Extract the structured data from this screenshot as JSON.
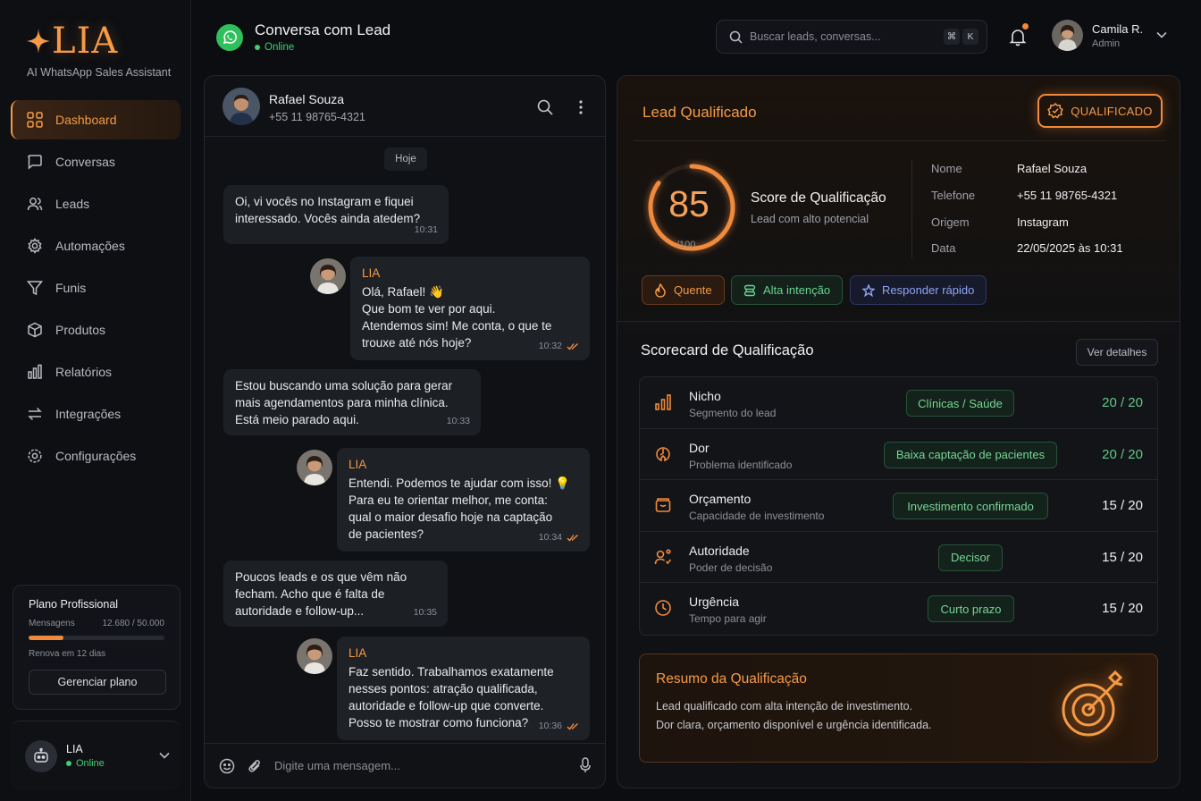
{
  "brand": {
    "name": "LIA",
    "tagline": "AI WhatsApp Sales Assistant",
    "accent": "#f59a45"
  },
  "sidebar": {
    "items": [
      {
        "label": "Dashboard",
        "icon": "grid-icon",
        "active": true
      },
      {
        "label": "Conversas",
        "icon": "chat-bubble-icon"
      },
      {
        "label": "Leads",
        "icon": "users-icon"
      },
      {
        "label": "Automações",
        "icon": "gear-icon"
      },
      {
        "label": "Funis",
        "icon": "funnel-icon"
      },
      {
        "label": "Produtos",
        "icon": "box-icon"
      },
      {
        "label": "Relatórios",
        "icon": "bar-chart-icon"
      },
      {
        "label": "Integrações",
        "icon": "arrows-swap-icon"
      },
      {
        "label": "Configurações",
        "icon": "settings-icon"
      }
    ],
    "plan": {
      "title": "Plano Profissional",
      "messages_label": "Mensagens",
      "messages_value": "12.680 / 50.000",
      "usage_fraction": 0.2536,
      "renew": "Renova em 12 dias",
      "button": "Gerenciar plano"
    },
    "bot": {
      "name": "LIA",
      "status": "Online"
    }
  },
  "header": {
    "title": "Conversa com Lead",
    "status": "Online",
    "search_placeholder": "Buscar leads, conversas...",
    "shortcut_cmd": "⌘",
    "shortcut_key": "K",
    "user": {
      "name": "Camila R.",
      "role": "Admin"
    }
  },
  "chat": {
    "contact": {
      "name": "Rafael Souza",
      "phone": "+55 11 98765-4321"
    },
    "day": "Hoje",
    "messages": [
      {
        "from": "lead",
        "lines": [
          "Oi, vi vocês no Instagram e fiquei",
          "interessado. Vocês ainda atedem?"
        ],
        "time": "10:31"
      },
      {
        "from": "LIA",
        "lines": [
          "Olá, Rafael! 👋",
          "Que bom te ver por aqui.",
          "Atendemos sim! Me conta, o que te",
          "trouxe até nós hoje?"
        ],
        "time": "10:32"
      },
      {
        "from": "lead",
        "lines": [
          "Estou buscando uma solução para gerar",
          "mais agendamentos para minha clínica.",
          "Está meio parado aqui."
        ],
        "time": "10:33"
      },
      {
        "from": "LIA",
        "lines": [
          "Entendi. Podemos te ajudar com isso! 💡",
          "Para eu te orientar melhor, me conta:",
          "qual o maior desafio hoje na captação",
          "de pacientes?"
        ],
        "time": "10:34"
      },
      {
        "from": "lead",
        "lines": [
          "Poucos leads e os que vêm não",
          "fecham. Acho que é falta de",
          "autoridade e follow-up..."
        ],
        "time": "10:35"
      },
      {
        "from": "LIA",
        "lines": [
          "Faz sentido. Trabalhamos exatamente",
          "nesses pontos: atração qualificada,",
          "autoridade e follow-up que converte.",
          "Posso te mostrar como funciona?"
        ],
        "time": "10:36"
      }
    ],
    "composer_placeholder": "Digite uma mensagem..."
  },
  "lead": {
    "title": "Lead Qualificado",
    "badge": "QUALIFICADO",
    "score": 85,
    "score_max": "/100",
    "score_title": "Score de Qualificação",
    "score_subtitle": "Lead com alto potencial",
    "info": [
      {
        "key": "Nome",
        "value": "Rafael Souza"
      },
      {
        "key": "Telefone",
        "value": "+55 11 98765-4321"
      },
      {
        "key": "Origem",
        "value": "Instagram"
      },
      {
        "key": "Data",
        "value": "22/05/2025 às 10:31"
      }
    ],
    "tags": [
      "Quente",
      "Alta intenção",
      "Responder rápido"
    ]
  },
  "scorecard": {
    "title": "Scorecard de Qualificação",
    "details_button": "Ver detalhes",
    "rows": [
      {
        "name": "Nicho",
        "desc": "Segmento do lead",
        "chip": "Clínicas / Saúde",
        "score": "20 / 20",
        "icon": "bar-chart-icon"
      },
      {
        "name": "Dor",
        "desc": "Problema identificado",
        "chip": "Baixa captação de pacientes",
        "score": "20 / 20",
        "icon": "pain-icon"
      },
      {
        "name": "Orçamento",
        "desc": "Capacidade de investimento",
        "chip": "Investimento confirmado",
        "score": "15 / 20",
        "icon": "wallet-icon"
      },
      {
        "name": "Autoridade",
        "desc": "Poder de decisão",
        "chip": "Decisor",
        "score": "15 / 20",
        "icon": "decision-maker-icon"
      },
      {
        "name": "Urgência",
        "desc": "Tempo para agir",
        "chip": "Curto prazo",
        "score": "15 / 20",
        "icon": "clock-icon"
      }
    ]
  },
  "summary": {
    "title": "Resumo da Qualificação",
    "line1": "Lead qualificado com alta intenção de investimento.",
    "line2": "Dor clara, orçamento disponível e urgência identificada."
  }
}
